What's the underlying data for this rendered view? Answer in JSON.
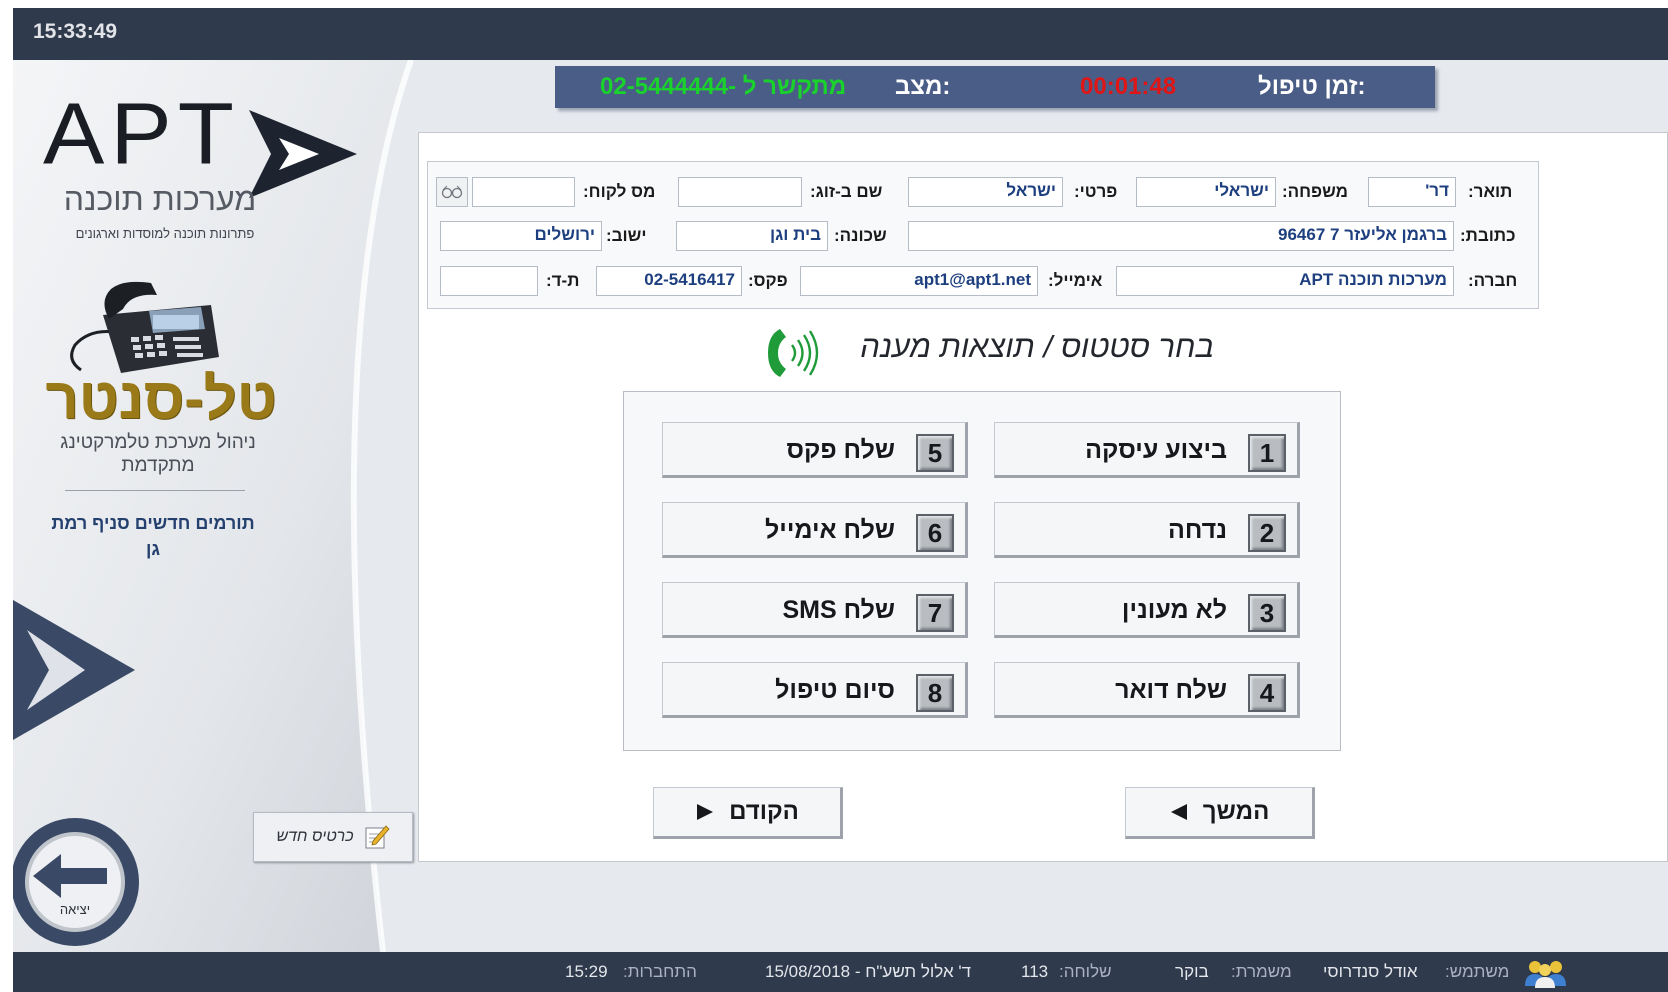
{
  "clock": "15:33:49",
  "sidebar": {
    "logo_text": "APT",
    "logo_hebrew": "מערכות תוכנה",
    "logo_tagline": "פתרונות תוכנה למוסדות וארגונים",
    "product_name": "טל-סנטר",
    "product_desc": "ניהול מערכת טלמרקטינג מתקדמת",
    "campaign": "תורמים חדשים סניף רמת גן",
    "new_card_label": "כרטיס חדש",
    "exit_label": "יציאה"
  },
  "status": {
    "handle_time_label": "זמן טיפול:",
    "handle_time_value": "00:01:48",
    "state_label": "מצב:",
    "state_value": "מתקשר ל -02-5444444"
  },
  "form": {
    "title_label": "תואר:",
    "title_value": "דר'",
    "lastname_label": "משפחה:",
    "lastname_value": "ישראלי",
    "firstname_label": "פרטי:",
    "firstname_value": "ישראל",
    "spouse_label": "שם ב-זוג:",
    "spouse_value": "",
    "customer_no_label": "מס לקוח:",
    "customer_no_value": "",
    "address_label": "כתובת:",
    "address_value": "ברגמן אליעזר 7 96467",
    "neighborhood_label": "שכונה:",
    "neighborhood_value": "בית וגן",
    "city_label": "ישוב:",
    "city_value": "ירושלים",
    "company_label": "חברה:",
    "company_value": "מערכות תוכנה APT",
    "email_label": "אימייל:",
    "email_value": "apt1@apt1.net",
    "fax_label": "פקס:",
    "fax_value": "02-5416417",
    "pobox_label": "ת-ד:",
    "pobox_value": ""
  },
  "section_title": "בחר סטטוס / תוצאות מענה",
  "results": [
    {
      "num": "1",
      "label": "ביצוע עיסקה"
    },
    {
      "num": "2",
      "label": "נדחה"
    },
    {
      "num": "3",
      "label": "לא מעונין"
    },
    {
      "num": "4",
      "label": "שלח דואר"
    },
    {
      "num": "5",
      "label": "שלח פקס"
    },
    {
      "num": "6",
      "label": "שלח אימייל"
    },
    {
      "num": "7",
      "label": "שלח SMS"
    },
    {
      "num": "8",
      "label": "סיום טיפול"
    }
  ],
  "nav": {
    "next_label": "המשך",
    "prev_label": "הקודם"
  },
  "footer": {
    "user_label": "משתמש:",
    "user_value": "אודל סנדרוסי",
    "shift_label": "משמרת:",
    "shift_value": "בוקר",
    "ext_label": "שלוחה:",
    "ext_value": "113",
    "date_value": "ד' אלול תשע\"ח - 15/08/2018",
    "login_label": "התחברות:",
    "login_value": "15:29"
  },
  "colors": {
    "topbar": "#2f3a4c",
    "status_bar": "#4a5d87",
    "handle_time": "#e01616",
    "state_value": "#19d22b",
    "product_gold": "#9a7a18",
    "field_text": "#1d3f7f"
  },
  "icons": [
    "apt-logo-arrow-icon",
    "desk-phone-icon",
    "new-card-icon",
    "exit-arrow-icon",
    "glasses-icon",
    "phone-answer-icon",
    "users-icon"
  ]
}
